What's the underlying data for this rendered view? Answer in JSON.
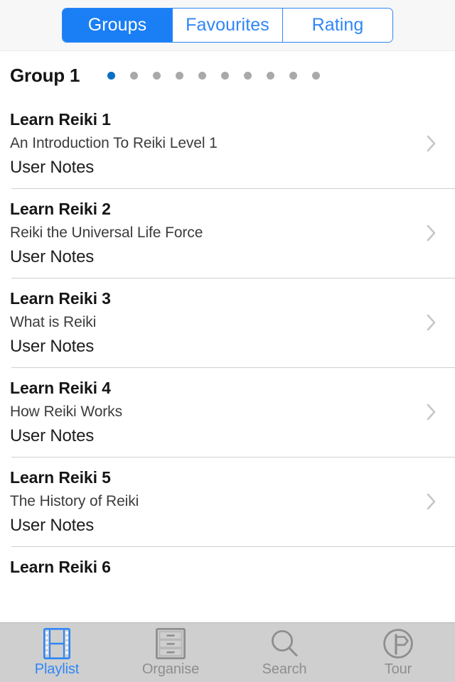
{
  "segmented_control": {
    "segments": [
      {
        "label": "Groups",
        "selected": true
      },
      {
        "label": "Favourites",
        "selected": false
      },
      {
        "label": "Rating",
        "selected": false
      }
    ]
  },
  "group_header": {
    "title": "Group 1",
    "page_dots": {
      "total": 10,
      "active_index": 0
    },
    "active_color": "#0b6fc4",
    "inactive_color": "#a9a9a9"
  },
  "list": {
    "notes_label": "User Notes",
    "items": [
      {
        "title": "Learn Reiki 1",
        "subtitle": "An Introduction To Reiki Level 1",
        "notes": "User Notes"
      },
      {
        "title": "Learn Reiki 2",
        "subtitle": "Reiki the Universal Life Force",
        "notes": "User Notes"
      },
      {
        "title": "Learn Reiki 3",
        "subtitle": "What is Reiki",
        "notes": "User Notes"
      },
      {
        "title": "Learn Reiki 4",
        "subtitle": "How Reiki Works",
        "notes": "User Notes"
      },
      {
        "title": "Learn Reiki 5",
        "subtitle": "The History of Reiki",
        "notes": "User Notes"
      },
      {
        "title": "Learn Reiki 6",
        "subtitle": "",
        "notes": ""
      }
    ]
  },
  "tab_bar": {
    "tabs": [
      {
        "label": "Playlist",
        "icon": "film-strip-icon",
        "active": true
      },
      {
        "label": "Organise",
        "icon": "file-cabinet-icon",
        "active": false
      },
      {
        "label": "Search",
        "icon": "search-icon",
        "active": false
      },
      {
        "label": "Tour",
        "icon": "signpost-icon",
        "active": false
      }
    ],
    "active_color": "#2f86f6",
    "inactive_color": "#8e8e8e"
  }
}
